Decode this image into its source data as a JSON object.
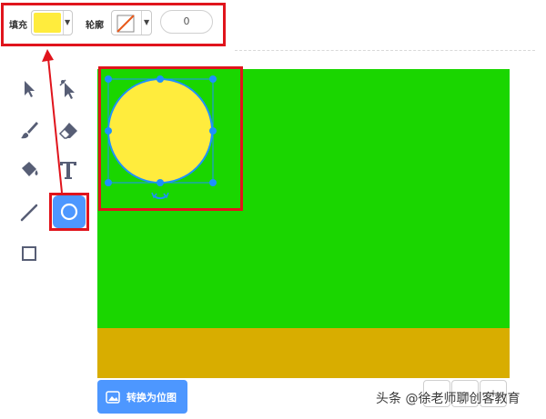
{
  "toolbar": {
    "fill_label": "填充",
    "fill_color": "#ffec3d",
    "stroke_label": "轮廓",
    "stroke_width": "0"
  },
  "tools": [
    {
      "name": "select",
      "icon": "arrow-icon"
    },
    {
      "name": "reshape",
      "icon": "reshape-icon"
    },
    {
      "name": "brush",
      "icon": "brush-icon"
    },
    {
      "name": "eraser",
      "icon": "eraser-icon"
    },
    {
      "name": "fill",
      "icon": "bucket-icon"
    },
    {
      "name": "text",
      "icon": "text-icon"
    },
    {
      "name": "line",
      "icon": "line-icon"
    },
    {
      "name": "circle",
      "icon": "circle-icon",
      "active": true
    },
    {
      "name": "rectangle",
      "icon": "square-icon"
    }
  ],
  "canvas": {
    "background_color": "#1ad600",
    "ground_color": "#d8ad00",
    "shape_fill": "#ffec3d",
    "selection_color": "#1e90ff"
  },
  "bottom": {
    "convert_label": "转换为位图"
  },
  "watermark": "头条 @徐老师聊创客教育",
  "colors": {
    "highlight": "#e0141c",
    "accent": "#4d97ff"
  }
}
